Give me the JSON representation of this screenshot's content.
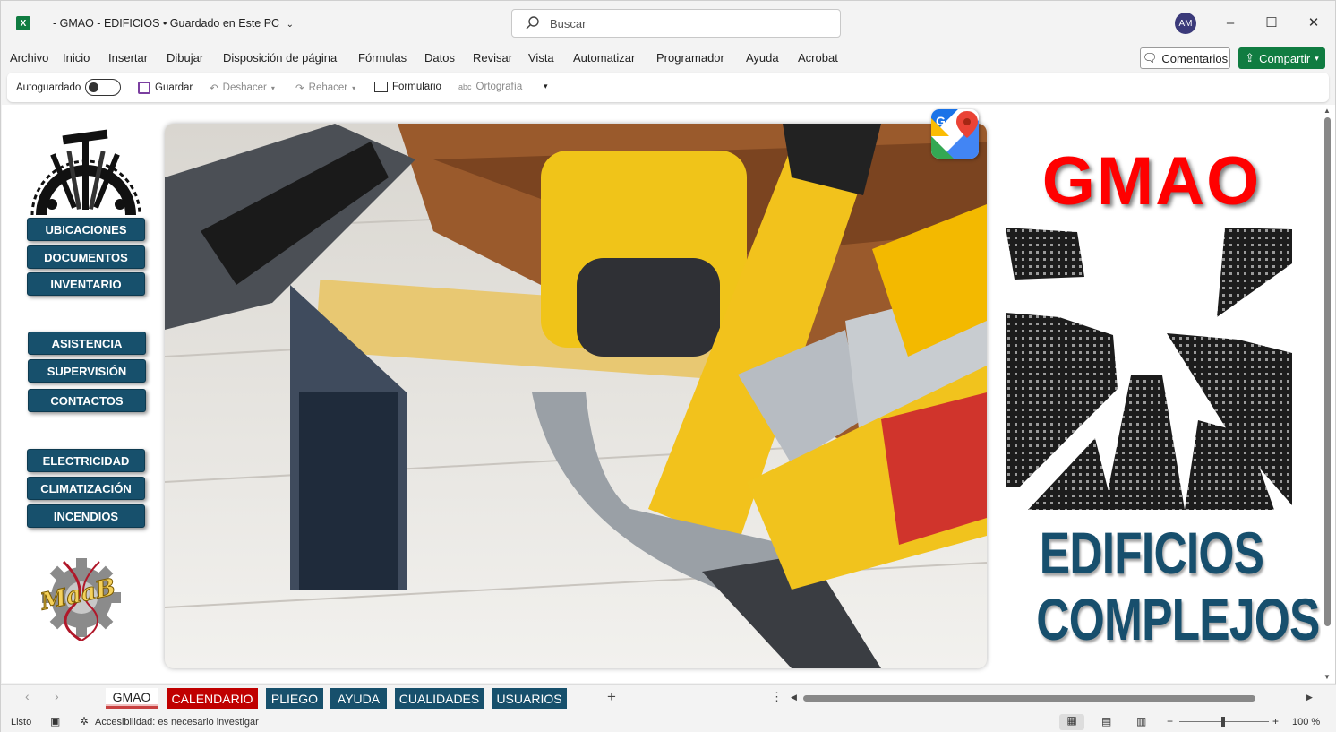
{
  "window": {
    "title": "- GMAO - EDIFICIOS",
    "save_state": "• Guardado en Este PC",
    "search_placeholder": "Buscar",
    "avatar_initials": "AM",
    "app_icon": "excel-icon"
  },
  "menu": [
    "Archivo",
    "Inicio",
    "Insertar",
    "Dibujar",
    "Disposición de página",
    "Fórmulas",
    "Datos",
    "Revisar",
    "Vista",
    "Automatizar",
    "Programador",
    "Ayuda",
    "Acrobat"
  ],
  "actions": {
    "comments": "Comentarios",
    "share": "Compartir"
  },
  "qat": {
    "autosave": "Autoguardado",
    "save": "Guardar",
    "undo": "Deshacer",
    "redo": "Rehacer",
    "form": "Formulario",
    "spelling": "Ortografía"
  },
  "nav_groups": [
    [
      "UBICACIONES",
      "DOCUMENTOS",
      "INVENTARIO"
    ],
    [
      "ASISTENCIA",
      "SUPERVISIÓN",
      "CONTACTOS"
    ],
    [
      "ELECTRICIDAD",
      "CLIMATIZACIÓN",
      "INCENDIOS"
    ]
  ],
  "brand": {
    "title": "GMAO",
    "line1": "EDIFICIOS",
    "line2": "COMPLEJOS",
    "logo_text": "MaaB",
    "accent_red": "#ff0000",
    "accent_blue": "#17506c"
  },
  "sheet_tabs": [
    {
      "label": "GMAO",
      "style": "active"
    },
    {
      "label": "CALENDARIO",
      "style": "red"
    },
    {
      "label": "PLIEGO",
      "style": "blue"
    },
    {
      "label": "AYUDA",
      "style": "blue"
    },
    {
      "label": "CUALIDADES",
      "style": "blue"
    },
    {
      "label": "USUARIOS",
      "style": "blue"
    }
  ],
  "status": {
    "ready": "Listo",
    "accessibility": "Accesibilidad: es necesario investigar",
    "zoom": "100 %"
  }
}
